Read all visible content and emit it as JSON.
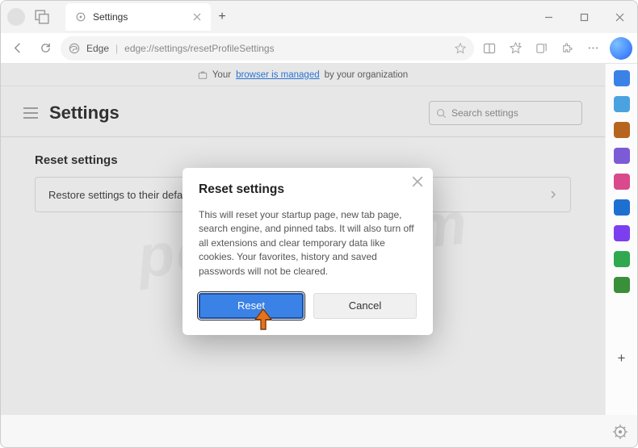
{
  "window": {
    "tab_title": "Settings",
    "address_app": "Edge",
    "address_path": "edge://settings/resetProfileSettings"
  },
  "managed_bar": {
    "prefix": "Your",
    "link": "browser is managed",
    "suffix": "by your organization"
  },
  "page": {
    "title": "Settings",
    "search_placeholder": "Search settings",
    "section_title": "Reset settings",
    "reset_row_label": "Restore settings to their default values"
  },
  "dialog": {
    "title": "Reset settings",
    "body": "This will reset your startup page, new tab page, search engine, and pinned tabs. It will also turn off all extensions and clear temporary data like cookies. Your favorites, history and saved passwords will not be cleared.",
    "primary": "Reset",
    "secondary": "Cancel"
  },
  "sidebar_icons": [
    {
      "name": "search-icon",
      "color": "#3b82e6"
    },
    {
      "name": "shopping-icon",
      "color": "#4aa3df"
    },
    {
      "name": "toolbox-icon",
      "color": "#b5651d"
    },
    {
      "name": "games-icon",
      "color": "#7b5cd6"
    },
    {
      "name": "tools-icon",
      "color": "#d94a8c"
    },
    {
      "name": "outlook-icon",
      "color": "#1f6fd0"
    },
    {
      "name": "drop-icon",
      "color": "#7b3ff0"
    },
    {
      "name": "image-icon",
      "color": "#2fa84f"
    },
    {
      "name": "tree-icon",
      "color": "#3a8f3a"
    }
  ],
  "watermark": "pcrisk.com"
}
